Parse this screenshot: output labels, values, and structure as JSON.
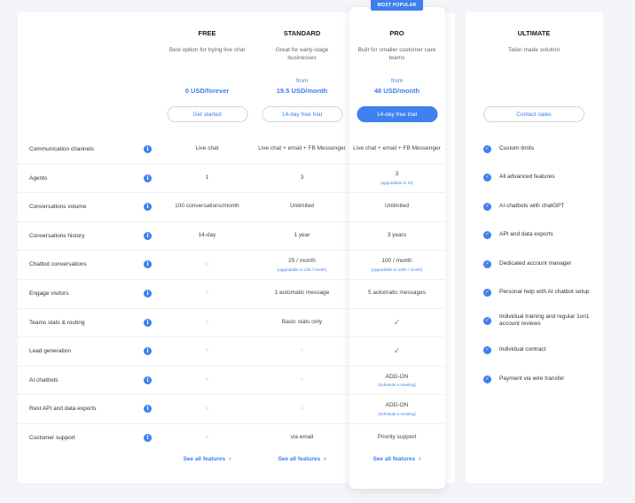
{
  "badge": "MOST POPULAR",
  "plans": [
    {
      "name": "FREE",
      "desc": "Best option for trying live chat",
      "from": "",
      "price": "0 USD/forever",
      "button": "Get started"
    },
    {
      "name": "STANDARD",
      "desc": "Great for early-stage businesses",
      "from": "from",
      "price": "19.5 USD/month",
      "button": "14-day free trial"
    },
    {
      "name": "PRO",
      "desc": "Built for smaller customer care teams",
      "from": "from",
      "price": "48 USD/month",
      "button": "14-day free trial"
    },
    {
      "name": "ULTIMATE",
      "desc": "Tailor-made solution",
      "from": "",
      "price": "",
      "button": "Contact sales"
    }
  ],
  "features": [
    {
      "label": "Communication channels",
      "free": "Live chat",
      "standard": "Live chat + email + FB Messenger",
      "pro": "Live chat + email + FB Messenger"
    },
    {
      "label": "Agents",
      "free": "1",
      "standard": "3",
      "pro": "3",
      "pro_sub": "(upgradable to 10)"
    },
    {
      "label": "Conversations volume",
      "free": "100 conversations/month",
      "standard": "Unlimited",
      "pro": "Unlimited"
    },
    {
      "label": "Conversations history",
      "free": "14-day",
      "standard": "1 year",
      "pro": "3 years"
    },
    {
      "label": "Chatbot conversations",
      "free": "×",
      "standard": "25 / month",
      "standard_sub": "(upgradable to 225 / month)",
      "pro": "100 / month",
      "pro_sub": "(upgradable to 1000 / month)"
    },
    {
      "label": "Engage visitors",
      "free": "×",
      "standard": "1 automatic message",
      "pro": "5 automatic messages"
    },
    {
      "label": "Teams stats & routing",
      "free": "×",
      "standard": "Basic stats only",
      "pro": "✓"
    },
    {
      "label": "Lead generation",
      "free": "×",
      "standard": "×",
      "pro": "✓"
    },
    {
      "label": "AI chatbots",
      "free": "×",
      "standard": "×",
      "pro": "ADD-ON",
      "pro_sub": "(Schedule a meeting)"
    },
    {
      "label": "Rest API and data exports",
      "free": "×",
      "standard": "×",
      "pro": "ADD-ON",
      "pro_sub": "(Schedule a meeting)"
    },
    {
      "label": "Customer support",
      "free": "×",
      "standard": "via email",
      "pro": "Priority support"
    }
  ],
  "see_all": "See all features",
  "ultimate_features": [
    "Custom limits",
    "All advanced features",
    "AI chatbots with chatGPT",
    "API and data exports",
    "Dedicated account manager",
    "Personal help with AI chatbot setup",
    "Individual training and regular 1on1 account reviews",
    "Individual contract",
    "Payment via wire transfer"
  ],
  "icons": {
    "info": "info-icon",
    "check": "check-circle-icon",
    "cross": "cross-icon",
    "chevron": "chevron-right-icon"
  },
  "colors": {
    "accent": "#3e80ed",
    "check_green": "#2ea76b",
    "cross_gray": "#d7dbe0"
  }
}
